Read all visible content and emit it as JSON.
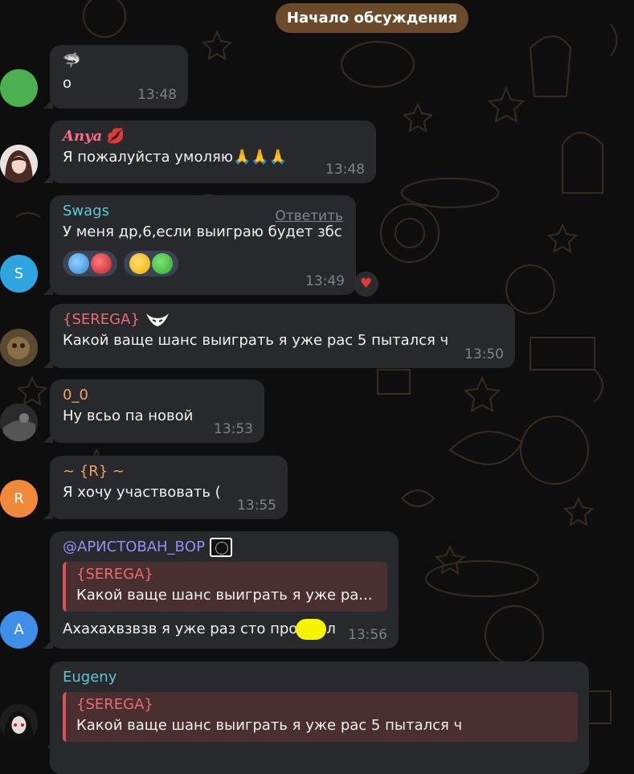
{
  "header": {
    "label": "Начало обсуждения"
  },
  "messages": [
    {
      "name": "",
      "name_emoji": "🦈",
      "text": "о",
      "time": "13:48",
      "name_color": "#8ec3ff",
      "avatar_letter": "",
      "avatar_color": "#4caf50"
    },
    {
      "name": "Anya",
      "name_emoji": "💋",
      "text": "Я пожалуйста умоляю",
      "text_emoji": "🙏🙏🙏",
      "time": "13:48",
      "name_color": "#ff6b8b",
      "avatar_letter": "",
      "avatar_color": "#6e4f3b"
    },
    {
      "name": "Swags",
      "text": "У меня др,6,если выиграю будет збс",
      "time": "13:49",
      "reply_label": "Ответить",
      "name_color": "#5fc7d6",
      "avatar_letter": "S",
      "avatar_color": "#2fa5e0",
      "heart": "♥"
    },
    {
      "name": "{SEREGA}",
      "text": "Какой ваще шанс выиграть я уже рас 5 пытался ч",
      "time": "13:50",
      "name_color": "#ec6a71",
      "avatar_letter": "",
      "avatar_color": "#6b5a3a"
    },
    {
      "name": "0_0",
      "text": "Ну всьо па новой",
      "time": "13:53",
      "name_color": "#f0a35e",
      "avatar_letter": "",
      "avatar_color": "#3a3a3a"
    },
    {
      "name": "~ {R} ~",
      "text": "Я хочу участвовать (",
      "time": "13:55",
      "name_color": "#f0a35e",
      "avatar_letter": "R",
      "avatar_color": "#f08a3a"
    },
    {
      "name": "@АРИСТОВАН_ВОР",
      "text": "Ахахахвзвзв я уже раз сто про",
      "text_tail": "л",
      "time": "13:56",
      "name_color": "#9b8cf5",
      "avatar_letter": "A",
      "avatar_color": "#3f8fe8",
      "quote": {
        "name": "{SEREGA}",
        "text": "Какой ваще шанс выиграть я уже ра..."
      }
    },
    {
      "name": "Eugeny",
      "text": "",
      "time": "",
      "name_color": "#5fc7d6",
      "avatar_letter": "",
      "avatar_color": "#444",
      "quote": {
        "name": "{SEREGA}",
        "text": "Какой ваще шанс выиграть я уже рас 5 пытался ч"
      }
    }
  ]
}
